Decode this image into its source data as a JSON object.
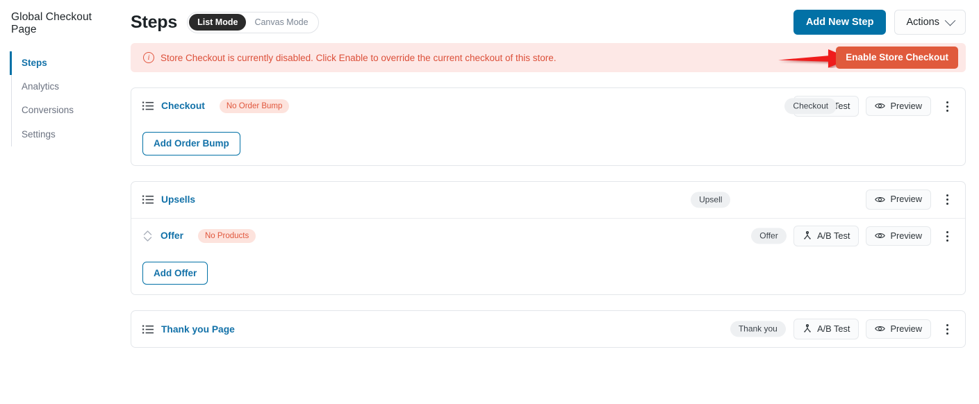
{
  "sidebar": {
    "title": "Global Checkout Page",
    "items": [
      {
        "label": "Steps",
        "active": true
      },
      {
        "label": "Analytics",
        "active": false
      },
      {
        "label": "Conversions",
        "active": false
      },
      {
        "label": "Settings",
        "active": false
      }
    ]
  },
  "header": {
    "title": "Steps",
    "modes": [
      {
        "label": "List Mode",
        "active": true
      },
      {
        "label": "Canvas Mode",
        "active": false
      }
    ],
    "add_new_step_label": "Add New Step",
    "actions_label": "Actions"
  },
  "notice": {
    "icon": "info-circle-icon",
    "text": "Store Checkout is currently disabled. Click Enable to override the current checkout of this store.",
    "button_label": "Enable Store Checkout",
    "bg_color": "#fde8e6",
    "text_color": "#dc4f39",
    "button_color": "#e05a3c"
  },
  "annotation": {
    "type": "arrow",
    "color": "#ef1c1c",
    "points_to": "Enable Store Checkout"
  },
  "cards": [
    {
      "rows": [
        {
          "lead_icon": "list-icon",
          "name": "Checkout",
          "tag": "No Order Bump",
          "type_pill": "Checkout",
          "actions": [
            {
              "label": "A/B Test",
              "icon": "ab-test-split-icon"
            },
            {
              "label": "Preview",
              "icon": "eye-icon"
            }
          ],
          "menu": "kebab-menu-icon"
        }
      ],
      "footer_button": "Add Order Bump"
    },
    {
      "rows": [
        {
          "lead_icon": "list-icon",
          "name": "Upsells",
          "tag": null,
          "type_pill": "Upsell",
          "actions": [
            {
              "label": "Preview",
              "icon": "eye-icon"
            }
          ],
          "menu": "kebab-menu-icon"
        },
        {
          "lead_icon": "sort-updown-icon",
          "name": "Offer",
          "tag": "No Products",
          "type_pill": "Offer",
          "actions": [
            {
              "label": "A/B Test",
              "icon": "ab-test-split-icon"
            },
            {
              "label": "Preview",
              "icon": "eye-icon"
            }
          ],
          "menu": "kebab-menu-icon"
        }
      ],
      "footer_button": "Add Offer"
    },
    {
      "rows": [
        {
          "lead_icon": "list-icon",
          "name": "Thank you Page",
          "tag": null,
          "type_pill": "Thank you",
          "actions": [
            {
              "label": "A/B Test",
              "icon": "ab-test-split-icon"
            },
            {
              "label": "Preview",
              "icon": "eye-icon"
            }
          ],
          "menu": "kebab-menu-icon"
        }
      ],
      "footer_button": null
    }
  ],
  "colors": {
    "accent_blue": "#0271a6",
    "link_blue": "#1271a8",
    "danger_red": "#e05a3c",
    "pill_grey": "#eef0f2"
  }
}
